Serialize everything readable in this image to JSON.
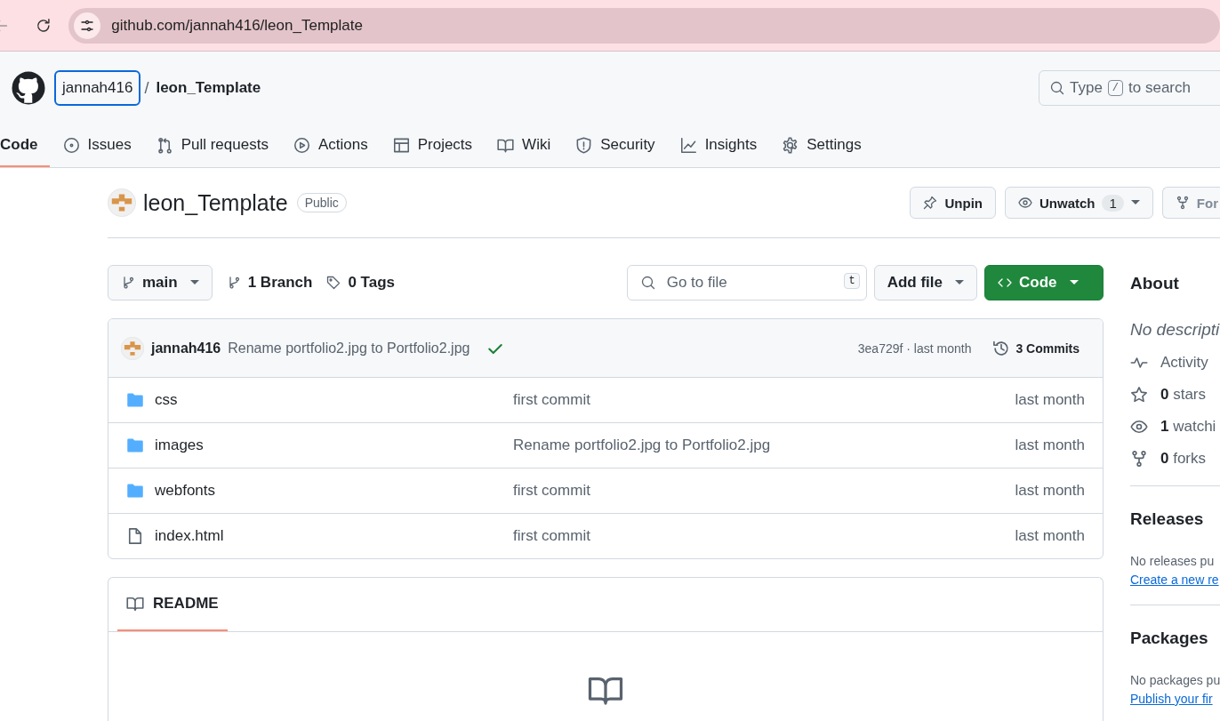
{
  "browser": {
    "url": "github.com/jannah416/leon_Template"
  },
  "header": {
    "owner": "jannah416",
    "separator": "/",
    "repo": "leon_Template",
    "search": {
      "before": "Type",
      "key": "/",
      "after": "to search"
    }
  },
  "tabs": [
    {
      "label": "Code",
      "selected": true
    },
    {
      "label": "Issues",
      "selected": false
    },
    {
      "label": "Pull requests",
      "selected": false
    },
    {
      "label": "Actions",
      "selected": false
    },
    {
      "label": "Projects",
      "selected": false
    },
    {
      "label": "Wiki",
      "selected": false
    },
    {
      "label": "Security",
      "selected": false
    },
    {
      "label": "Insights",
      "selected": false
    },
    {
      "label": "Settings",
      "selected": false
    }
  ],
  "repo": {
    "name": "leon_Template",
    "visibility": "Public",
    "buttons": [
      {
        "label": "Unpin"
      },
      {
        "label": "Unwatch",
        "count": "1"
      },
      {
        "label": "For"
      }
    ]
  },
  "toolbar": {
    "branch": "main",
    "branches": "1 Branch",
    "tags": "0 Tags",
    "file_search": {
      "placeholder": "Go to file",
      "key": "t"
    },
    "add_file": "Add file",
    "code": "Code"
  },
  "commit": {
    "author": "jannah416",
    "message": "Rename portfolio2.jpg to Portfolio2.jpg",
    "hash_time": "3ea729f · last month",
    "commits": "3 Commits"
  },
  "files": [
    {
      "kind": "folder",
      "name": "css",
      "message": "first commit",
      "time": "last month"
    },
    {
      "kind": "folder",
      "name": "images",
      "message": "Rename portfolio2.jpg to Portfolio2.jpg",
      "time": "last month"
    },
    {
      "kind": "folder",
      "name": "webfonts",
      "message": "first commit",
      "time": "last month"
    },
    {
      "kind": "file",
      "name": "index.html",
      "message": "first commit",
      "time": "last month"
    }
  ],
  "readme": {
    "title": "README"
  },
  "about": {
    "title": "About",
    "description": "No descripti",
    "stats": [
      {
        "kind": "activity",
        "text": "Activity"
      },
      {
        "kind": "star",
        "text": "**0** stars"
      },
      {
        "kind": "eye",
        "text": "**1** watchi"
      },
      {
        "kind": "fork",
        "text": "**0** forks"
      }
    ],
    "sections": [
      {
        "title": "Releases",
        "text": "No releases pu",
        "link": "Create a new re"
      },
      {
        "title": "Packages",
        "text": "No packages pu",
        "link": "Publish your fir"
      }
    ]
  }
}
